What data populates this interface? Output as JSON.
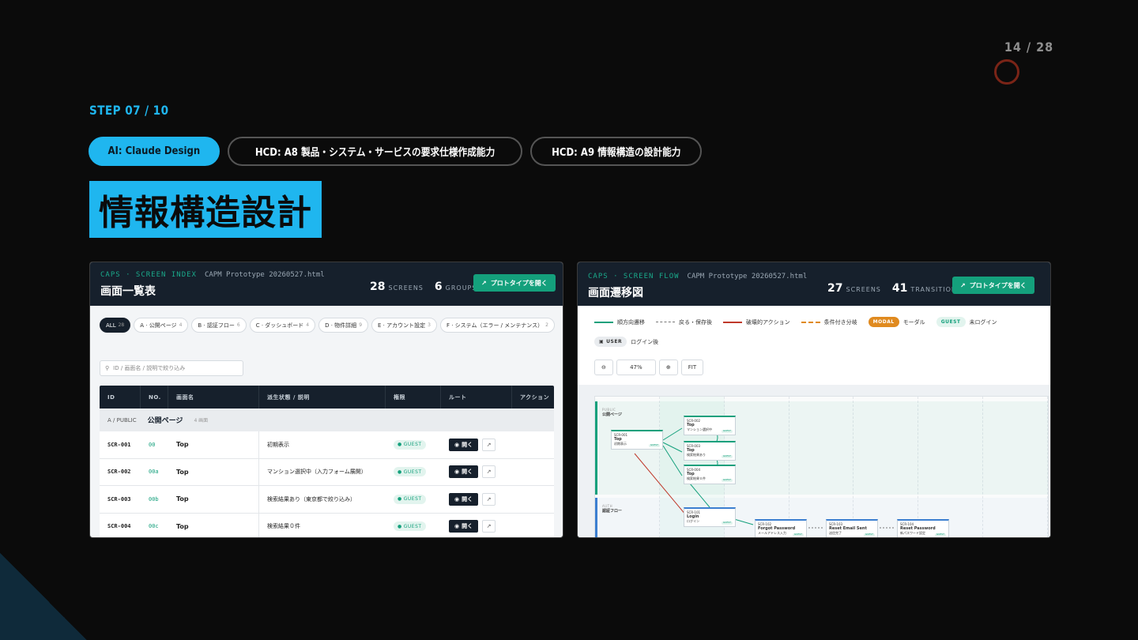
{
  "pager": "14 / 28",
  "step": "STEP 07 / 10",
  "tags": [
    {
      "label": "AI: Claude Design",
      "active": true
    },
    {
      "label": "HCD: A8 製品・システム・サービスの要求仕様作成能力",
      "active": false
    },
    {
      "label": "HCD: A9 情報構造の設計能力",
      "active": false
    }
  ],
  "title": "情報構造設計",
  "screen_index": {
    "kicker": "CAPS · SCREEN INDEX",
    "file": "CAPM Prototype 20260527.html",
    "title": "画面一覧表",
    "stat1_num": "28",
    "stat1_label": "SCREENS",
    "stat2_num": "6",
    "stat2_label": "GROUPS",
    "open_button": "プロトタイプを開く",
    "filters": [
      {
        "label": "ALL",
        "count": "28",
        "active": true
      },
      {
        "label": "A · 公開ページ",
        "count": "4"
      },
      {
        "label": "B · 認証フロー",
        "count": "6"
      },
      {
        "label": "C · ダッシュボード",
        "count": "4"
      },
      {
        "label": "D · 物件詳細",
        "count": "9"
      },
      {
        "label": "E · アカウント設定",
        "count": "3"
      },
      {
        "label": "F · システム（エラー / メンテナンス）",
        "count": "2"
      }
    ],
    "search_placeholder": "ID / 画面名 / 説明で絞り込み",
    "columns": [
      "ID",
      "NO.",
      "画面名",
      "派生状態 / 説明",
      "権限",
      "ルート",
      "アクション"
    ],
    "group_code": "A / PUBLIC",
    "group_name": "公開ページ",
    "group_count": "4 画面",
    "rows": [
      {
        "id": "SCR-001",
        "no": "00",
        "name": "Top",
        "desc": "初期表示",
        "role": "GUEST",
        "open": "開く"
      },
      {
        "id": "SCR-002",
        "no": "00a",
        "name": "Top",
        "desc": "マンション選択中（入力フォーム展開）",
        "role": "GUEST",
        "open": "開く"
      },
      {
        "id": "SCR-003",
        "no": "00b",
        "name": "Top",
        "desc": "検索結果あり（東京都で絞り込み）",
        "role": "GUEST",
        "open": "開く"
      },
      {
        "id": "SCR-004",
        "no": "00c",
        "name": "Top",
        "desc": "検索結果０件",
        "role": "GUEST",
        "open": "開く"
      }
    ]
  },
  "screen_flow": {
    "kicker": "CAPS · SCREEN FLOW",
    "file": "CAPM Prototype 20260527.html",
    "title": "画面遷移図",
    "stat1_num": "27",
    "stat1_label": "SCREENS",
    "stat2_num": "41",
    "stat2_label": "TRANSITIONS",
    "open_button": "プロトタイプを開く",
    "legend": [
      {
        "label": "順方向遷移"
      },
      {
        "label": "戻る・保存後"
      },
      {
        "label": "破壊的アクション"
      },
      {
        "label": "条件付き分岐"
      }
    ],
    "pill_modal": "MODAL",
    "pill_modal_label": "モーダル",
    "pill_guest": "GUEST",
    "pill_guest_label": "未ログイン",
    "pill_user": "USER",
    "pill_user_label": "ログイン後",
    "zoom": "47%",
    "fit": "FIT",
    "lane1": {
      "code": "PUBLIC",
      "name": "公開ページ"
    },
    "lane2": {
      "code": "AUTH",
      "name": "認証フロー"
    },
    "nodes": [
      {
        "id": "SCR-001",
        "name": "Top",
        "desc": "初期表示"
      },
      {
        "id": "SCR-002",
        "name": "Top",
        "desc": "マンション選択中"
      },
      {
        "id": "SCR-003",
        "name": "Top",
        "desc": "検索結果あり"
      },
      {
        "id": "SCR-004",
        "name": "Top",
        "desc": "検索結果０件"
      },
      {
        "id": "SCR-101",
        "name": "Login",
        "desc": "ログイン"
      },
      {
        "id": "SCR-102",
        "name": "Forgot Password",
        "desc": "メールアドレス入力"
      },
      {
        "id": "SCR-103",
        "name": "Reset Email Sent",
        "desc": "送信完了"
      },
      {
        "id": "SCR-104",
        "name": "Reset Password",
        "desc": "新パスワード設定"
      }
    ]
  }
}
